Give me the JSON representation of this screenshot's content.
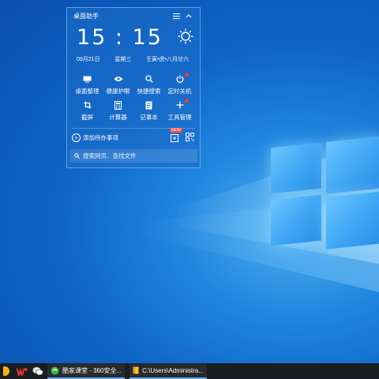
{
  "widget": {
    "title": "桌面助手",
    "time": "15 : 15",
    "date": "09月21日",
    "weekday": "星期三",
    "lunar": "壬寅•虎•八月廿六",
    "tools_row1": [
      {
        "label": "桌面整理",
        "icon": "desktop-icon"
      },
      {
        "label": "健康护眼",
        "icon": "eye-icon"
      },
      {
        "label": "快捷搜索",
        "icon": "search-icon"
      },
      {
        "label": "定时关机",
        "icon": "power-icon"
      }
    ],
    "tools_row2": [
      {
        "label": "截屏",
        "icon": "crop-icon"
      },
      {
        "label": "计算器",
        "icon": "calculator-icon"
      },
      {
        "label": "记事本",
        "icon": "notepad-icon"
      },
      {
        "label": "工具管理",
        "icon": "plus-icon"
      }
    ],
    "todo_label": "添加待办事项",
    "new_badge": "NEW",
    "search_placeholder": "搜索网页、查找文件"
  },
  "taskbar": {
    "app1": "酷家课堂 - 360安全...",
    "app2": "C:\\Users\\Administra..."
  },
  "colors": {
    "accent": "#1f86df",
    "taskbar": "#1a1d22",
    "red_dot": "#ff3b3b"
  }
}
